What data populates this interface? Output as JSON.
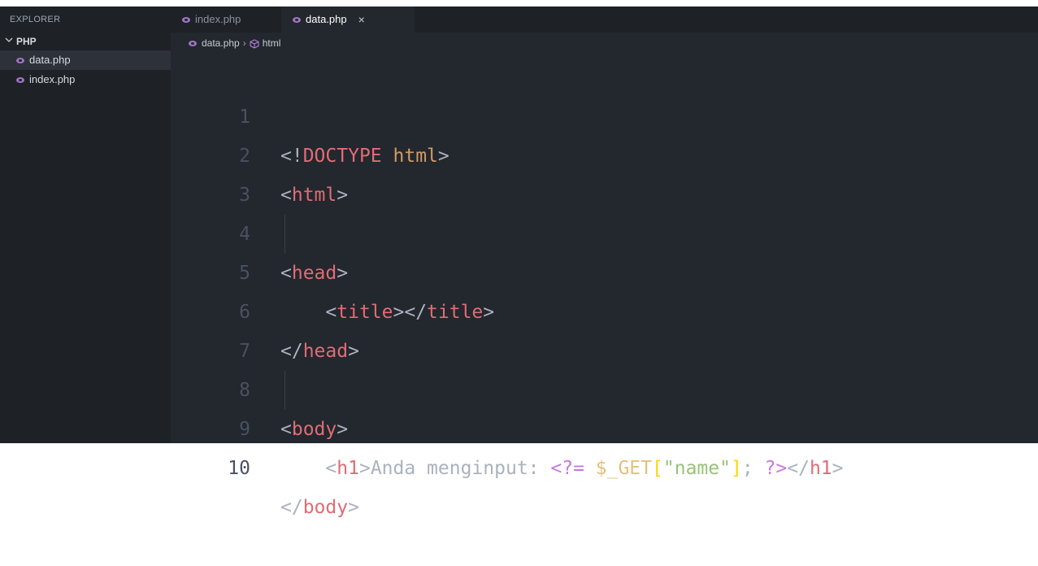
{
  "sidebar": {
    "title": "EXPLORER",
    "folder": "PHP",
    "files": [
      {
        "name": "data.php",
        "active": true
      },
      {
        "name": "index.php",
        "active": false
      }
    ]
  },
  "tabs": [
    {
      "label": "index.php",
      "active": false
    },
    {
      "label": "data.php",
      "active": true,
      "close": "×"
    }
  ],
  "breadcrumb": {
    "file": "data.php",
    "separator": "›",
    "symbol": "html"
  },
  "editor": {
    "line_numbers": [
      "1",
      "2",
      "3",
      "4",
      "5",
      "6",
      "7",
      "8",
      "9",
      "10"
    ],
    "lines": [
      {
        "l1": {
          "open": "<!",
          "doctype": "DOCTYPE",
          "sp": " ",
          "html": "html",
          "close": ">"
        }
      },
      {
        "l2": {
          "open": "<",
          "tag": "html",
          "close": ">"
        }
      },
      {},
      {
        "l4": {
          "open": "<",
          "tag": "head",
          "close": ">"
        }
      },
      {
        "l5": {
          "indent": "    ",
          "open": "<",
          "tag": "title",
          "mid": "></",
          "tag2": "title",
          "close": ">"
        }
      },
      {
        "l6": {
          "open": "</",
          "tag": "head",
          "close": ">"
        }
      },
      {},
      {
        "l8": {
          "open": "<",
          "tag": "body",
          "close": ">"
        }
      },
      {
        "l9": {
          "indent": "    ",
          "open": "<",
          "tag": "h1",
          "close": ">",
          "text": "Anda menginput: ",
          "php_open": "<?= ",
          "var": "$_GET",
          "lb": "[",
          "str": "\"name\"",
          "rb": "]",
          "semi": "; ",
          "php_close": "?>",
          "end_open": "</",
          "end_tag": "h1",
          "end_close": ">"
        }
      },
      {
        "l10": {
          "open": "</",
          "tag": "body",
          "close": ">"
        }
      }
    ]
  },
  "colors": {
    "editor_bg": "#23272e",
    "sidebar_bg": "#1e2227",
    "tag": "#e06c75",
    "keyword": "#c678dd",
    "variable": "#e5c07b",
    "string": "#98c379",
    "bracket": "#ffd700",
    "line_number": "#495162"
  }
}
